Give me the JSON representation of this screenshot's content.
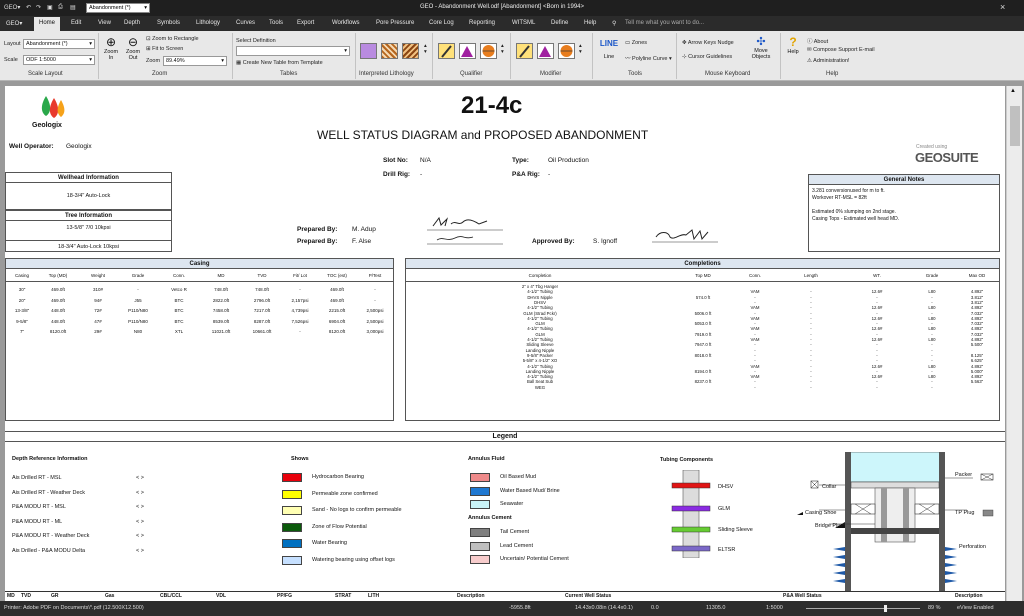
{
  "titlebar": {
    "layout_value": "Abandonment (*)",
    "title": "GEO - Abandonment Well.odf [Abandonment] <Born in 1994>",
    "search": "Tell me what you want to do..."
  },
  "menu": [
    "Home",
    "Edit",
    "View",
    "Depth",
    "Symbols",
    "Lithology",
    "Curves",
    "Tools",
    "Export",
    "Workflows",
    "Pore Pressure",
    "Core Log",
    "Reporting",
    "WITSML",
    "Define",
    "Help"
  ],
  "ribbon": {
    "layout_label": "Layout",
    "layout_value": "Abandonment (*)",
    "scale_label": "Scale",
    "scale_value": "ODF 1:5000",
    "scale_layout": "Scale Layout",
    "zoom_in": "Zoom In",
    "zoom_out": "Zoom Out",
    "zoom_rect": "Zoom to Rectangle",
    "fit_screen": "Fit to Screen",
    "zoom_label": "Zoom",
    "zoom_value": "89.49%",
    "zoom_group": "Zoom",
    "select_def": "Select Definition",
    "create_table": "Create New Table from Template",
    "tables_group": "Tables",
    "interp_lith": "Interpreted Lithology",
    "qualifier": "Qualifier",
    "modifier": "Modifier",
    "line": "LINE",
    "line_label": "Line",
    "zones": "Zones",
    "polyline": "Polyline Curve",
    "tools_group": "Tools",
    "arrow_keys": "Arrow Keys Nudge",
    "cursor_guides": "Cursor Guidelines",
    "move_objects": "Move Objects",
    "mouse_group": "Mouse Keyboard",
    "help": "Help",
    "about": "About",
    "compose": "Compose Support E-mail",
    "admin": "Administration!",
    "help_group": "Help"
  },
  "doc": {
    "logo": "Geologix",
    "well_name": "21-4c",
    "subtitle": "WELL STATUS DIAGRAM and PROPOSED ABANDONMENT",
    "operator_label": "Well Operator:",
    "operator": "Geologix",
    "slot_label": "Slot No:",
    "slot": "N/A",
    "rig_label": "Drill Rig:",
    "rig": "-",
    "type_label": "Type:",
    "type": "Oil Production",
    "pa_label": "P&A Rig:",
    "pa": "-",
    "created_using": "Created using",
    "geosuite": "GEOSUITE",
    "wellhead_h": "Wellhead Information",
    "wellhead": "18-3/4\" Auto-Lock",
    "tree_h": "Tree Information",
    "tree1": "13-5/8\" 7/0 10kpsi",
    "tree2": "18-3/4\" Auto-Lock 10kpsi",
    "prep1_label": "Prepared By:",
    "prep1": "M. Adup",
    "prep2_label": "Prepared By:",
    "prep2": "F. Alse",
    "appr_label": "Approved By:",
    "appr": "S. Ignoff",
    "notes_h": "General Notes",
    "notes": [
      "3.281 conversionused for m to ft.",
      "Workover RT-MSL = 82ft",
      "",
      "Estimated 0% slumping on 2nd stage.",
      "Casing Tops - Estimated well head MD."
    ]
  },
  "casing": {
    "title": "Casing",
    "headers": [
      "Casing",
      "Top (MD)",
      "Weight",
      "Grade",
      "Conn.",
      "MD",
      "TVD",
      "Fit/ Lot",
      "TOC (est)",
      "P/Test"
    ],
    "rows": [
      [
        "30\"",
        "469.0ft",
        "310#",
        "-",
        "Vetco R",
        "748.0ft",
        "748.0ft",
        "-",
        "469.0ft",
        "-"
      ],
      [
        "20\"",
        "469.0ft",
        "94#",
        "J55",
        "BTC",
        "2822.0ft",
        "2796.0ft",
        "2,157psi",
        "469.0ft",
        "-"
      ],
      [
        "13-3/8\"",
        "448.0ft",
        "72#",
        "P110/N80",
        "BTC",
        "7458.0ft",
        "7217.0ft",
        "4,739psi",
        "2215.0ft",
        "2,500psi"
      ],
      [
        "9-5/8\"",
        "448.0ft",
        "47#",
        "P110/N80",
        "BTC",
        "8539.0ft",
        "8287.0ft",
        "7,526psi",
        "6904.0ft",
        "2,500psi"
      ],
      [
        "7\"",
        "8120.0ft",
        "29#",
        "N80",
        "XTL",
        "11021.0ft",
        "10661.0ft",
        "-",
        "8120.0ft",
        "3,000psi"
      ]
    ]
  },
  "completions": {
    "title": "Completions",
    "headers": [
      "Completion",
      "Top MD",
      "Conn.",
      "Length",
      "WT.",
      "Grade",
      "Max OD"
    ],
    "items": [
      "2\" x 4\" Tbg Hanger",
      "4-1/2\" Tubing",
      "DHVS Nipple",
      "DHSV",
      "4-1/2\" Tubing",
      "GLM (Strad Pckr)",
      "4-1/2\" Tubing",
      "GLM",
      "4-1/2\" Tubing",
      "GLM",
      "4-1/2\" Tubing",
      "Sliding Sleeve",
      "Landing Nipple",
      "9-5/8\" Packer",
      "5-5/8\" x 4-1/2\" XO",
      "4-1/2\" Tubing",
      "Landing Nipple",
      "4-1/2\" Tubing",
      "Ball Seat Sub",
      "WEG"
    ],
    "topmd": [
      "",
      "",
      "574.0 ft",
      "",
      "",
      "5006.0 ft",
      "",
      "5053.0 ft",
      "",
      "7919.0 ft",
      "",
      "7947.0 ft",
      "",
      "8018.0 ft",
      "",
      "",
      "8194.0 ft",
      "",
      "8237.0 ft",
      ""
    ],
    "conn": [
      "",
      "VAM",
      "-",
      "-",
      "VAM",
      "-",
      "VAM",
      "-",
      "VAM",
      "-",
      "VAM",
      "-",
      "-",
      "-",
      "-",
      "VAM",
      "-",
      "VAM",
      "-",
      "-"
    ],
    "length": [
      "",
      "-",
      "-",
      "-",
      "-",
      "-",
      "-",
      "-",
      "-",
      "-",
      "-",
      "-",
      "-",
      "-",
      "-",
      "-",
      "-",
      "-",
      "-",
      "-"
    ],
    "wt": [
      "",
      "12.6#",
      "-",
      "-",
      "12.6#",
      "-",
      "12.6#",
      "-",
      "12.6#",
      "-",
      "12.6#",
      "-",
      "-",
      "-",
      "-",
      "12.6#",
      "-",
      "12.6#",
      "-",
      "-"
    ],
    "grade": [
      "",
      "L80",
      "-",
      "-",
      "L80",
      "-",
      "L80",
      "-",
      "L80",
      "-",
      "L80",
      "-",
      "-",
      "-",
      "-",
      "L80",
      "-",
      "L80",
      "-",
      "-"
    ],
    "maxod": [
      "",
      "4.892\"",
      "3.812\"",
      "3.812\"",
      "4.892\"",
      "7.032\"",
      "4.892\"",
      "7.032\"",
      "4.892\"",
      "7.032\"",
      "4.892\"",
      "5.500\"",
      "",
      "8.125\"",
      "6.625\"",
      "4.892\"",
      "5.000\"",
      "4.892\"",
      "5.563\"",
      ""
    ]
  },
  "legend": {
    "title": "Legend",
    "depth_h": "Depth Reference Information",
    "depth_rows": [
      [
        "Ais Drilled RT - MSL",
        "< >"
      ],
      [
        "Ais Drilled RT - Weather Deck",
        "< >"
      ],
      [
        "P&A MODU RT - MSL",
        "< >"
      ],
      [
        "P&A MODU RT - ML",
        "< >"
      ],
      [
        "P&A MODU RT - Weather Deck",
        "< >"
      ],
      [
        "Ais Drilled - P&A MODU Delta",
        "< >"
      ]
    ],
    "shows_h": "Shows",
    "shows": [
      {
        "label": "Hydrocarbon Bearing",
        "color": "#e8000b"
      },
      {
        "label": "Permeable zone confirmed",
        "color": "#ffff00"
      },
      {
        "label": "Sand - No logs to confirm permeable",
        "color": "#ffffb3"
      },
      {
        "label": "Zone of Flow Potential",
        "color": "#0b5a0b"
      },
      {
        "label": "Water Bearing",
        "color": "#0070c0"
      },
      {
        "label": "Watering bearing using offset logs",
        "color": "#c6e0ff"
      }
    ],
    "annulus_h": "Annulus Fluid",
    "annulus": [
      {
        "label": "Oil Based Mud",
        "color": "#ef8a8a"
      },
      {
        "label": "Water Based Mud/ Brine",
        "color": "#1f78d1"
      },
      {
        "label": "Seawater",
        "color": "#c9f3f7"
      }
    ],
    "cement_h": "Annulus Cement",
    "cement": [
      {
        "label": "Tail Cement",
        "color": "#7f7f7f"
      },
      {
        "label": "Lead Cement",
        "color": "#bfbfbf"
      },
      {
        "label": "Uncertain/ Potential Cement",
        "color": "#f7cccc"
      }
    ],
    "tubing_h": "Tubing Components",
    "tubing": [
      "DHSV",
      "GLM",
      "Sliding Sleeve",
      "ELTSR"
    ],
    "diagram": [
      "Collar",
      "Casing Shoe",
      "Bridge Plug",
      "Packer",
      "TP Plug",
      "Perforation"
    ]
  },
  "bottom_headers": [
    "MD",
    "TVD",
    "GR",
    "Gas",
    "CBL/CCL",
    "VDL",
    "PP/FG",
    "STRAT",
    "LITH",
    "Description",
    "Current Well Status",
    "P&A Well Status",
    "Description"
  ],
  "status": {
    "printer": "Printer: Adobe PDF on Documents\\*.pdf (12.500X12.500)",
    "depth": "-5955.8ft",
    "coords": "14.43x0.08in (14.4x0.1)",
    "v1": "0.0",
    "v2": "11305.0",
    "scale": "1:5000",
    "zoom": "89 %",
    "eview": "eView Enabled"
  }
}
